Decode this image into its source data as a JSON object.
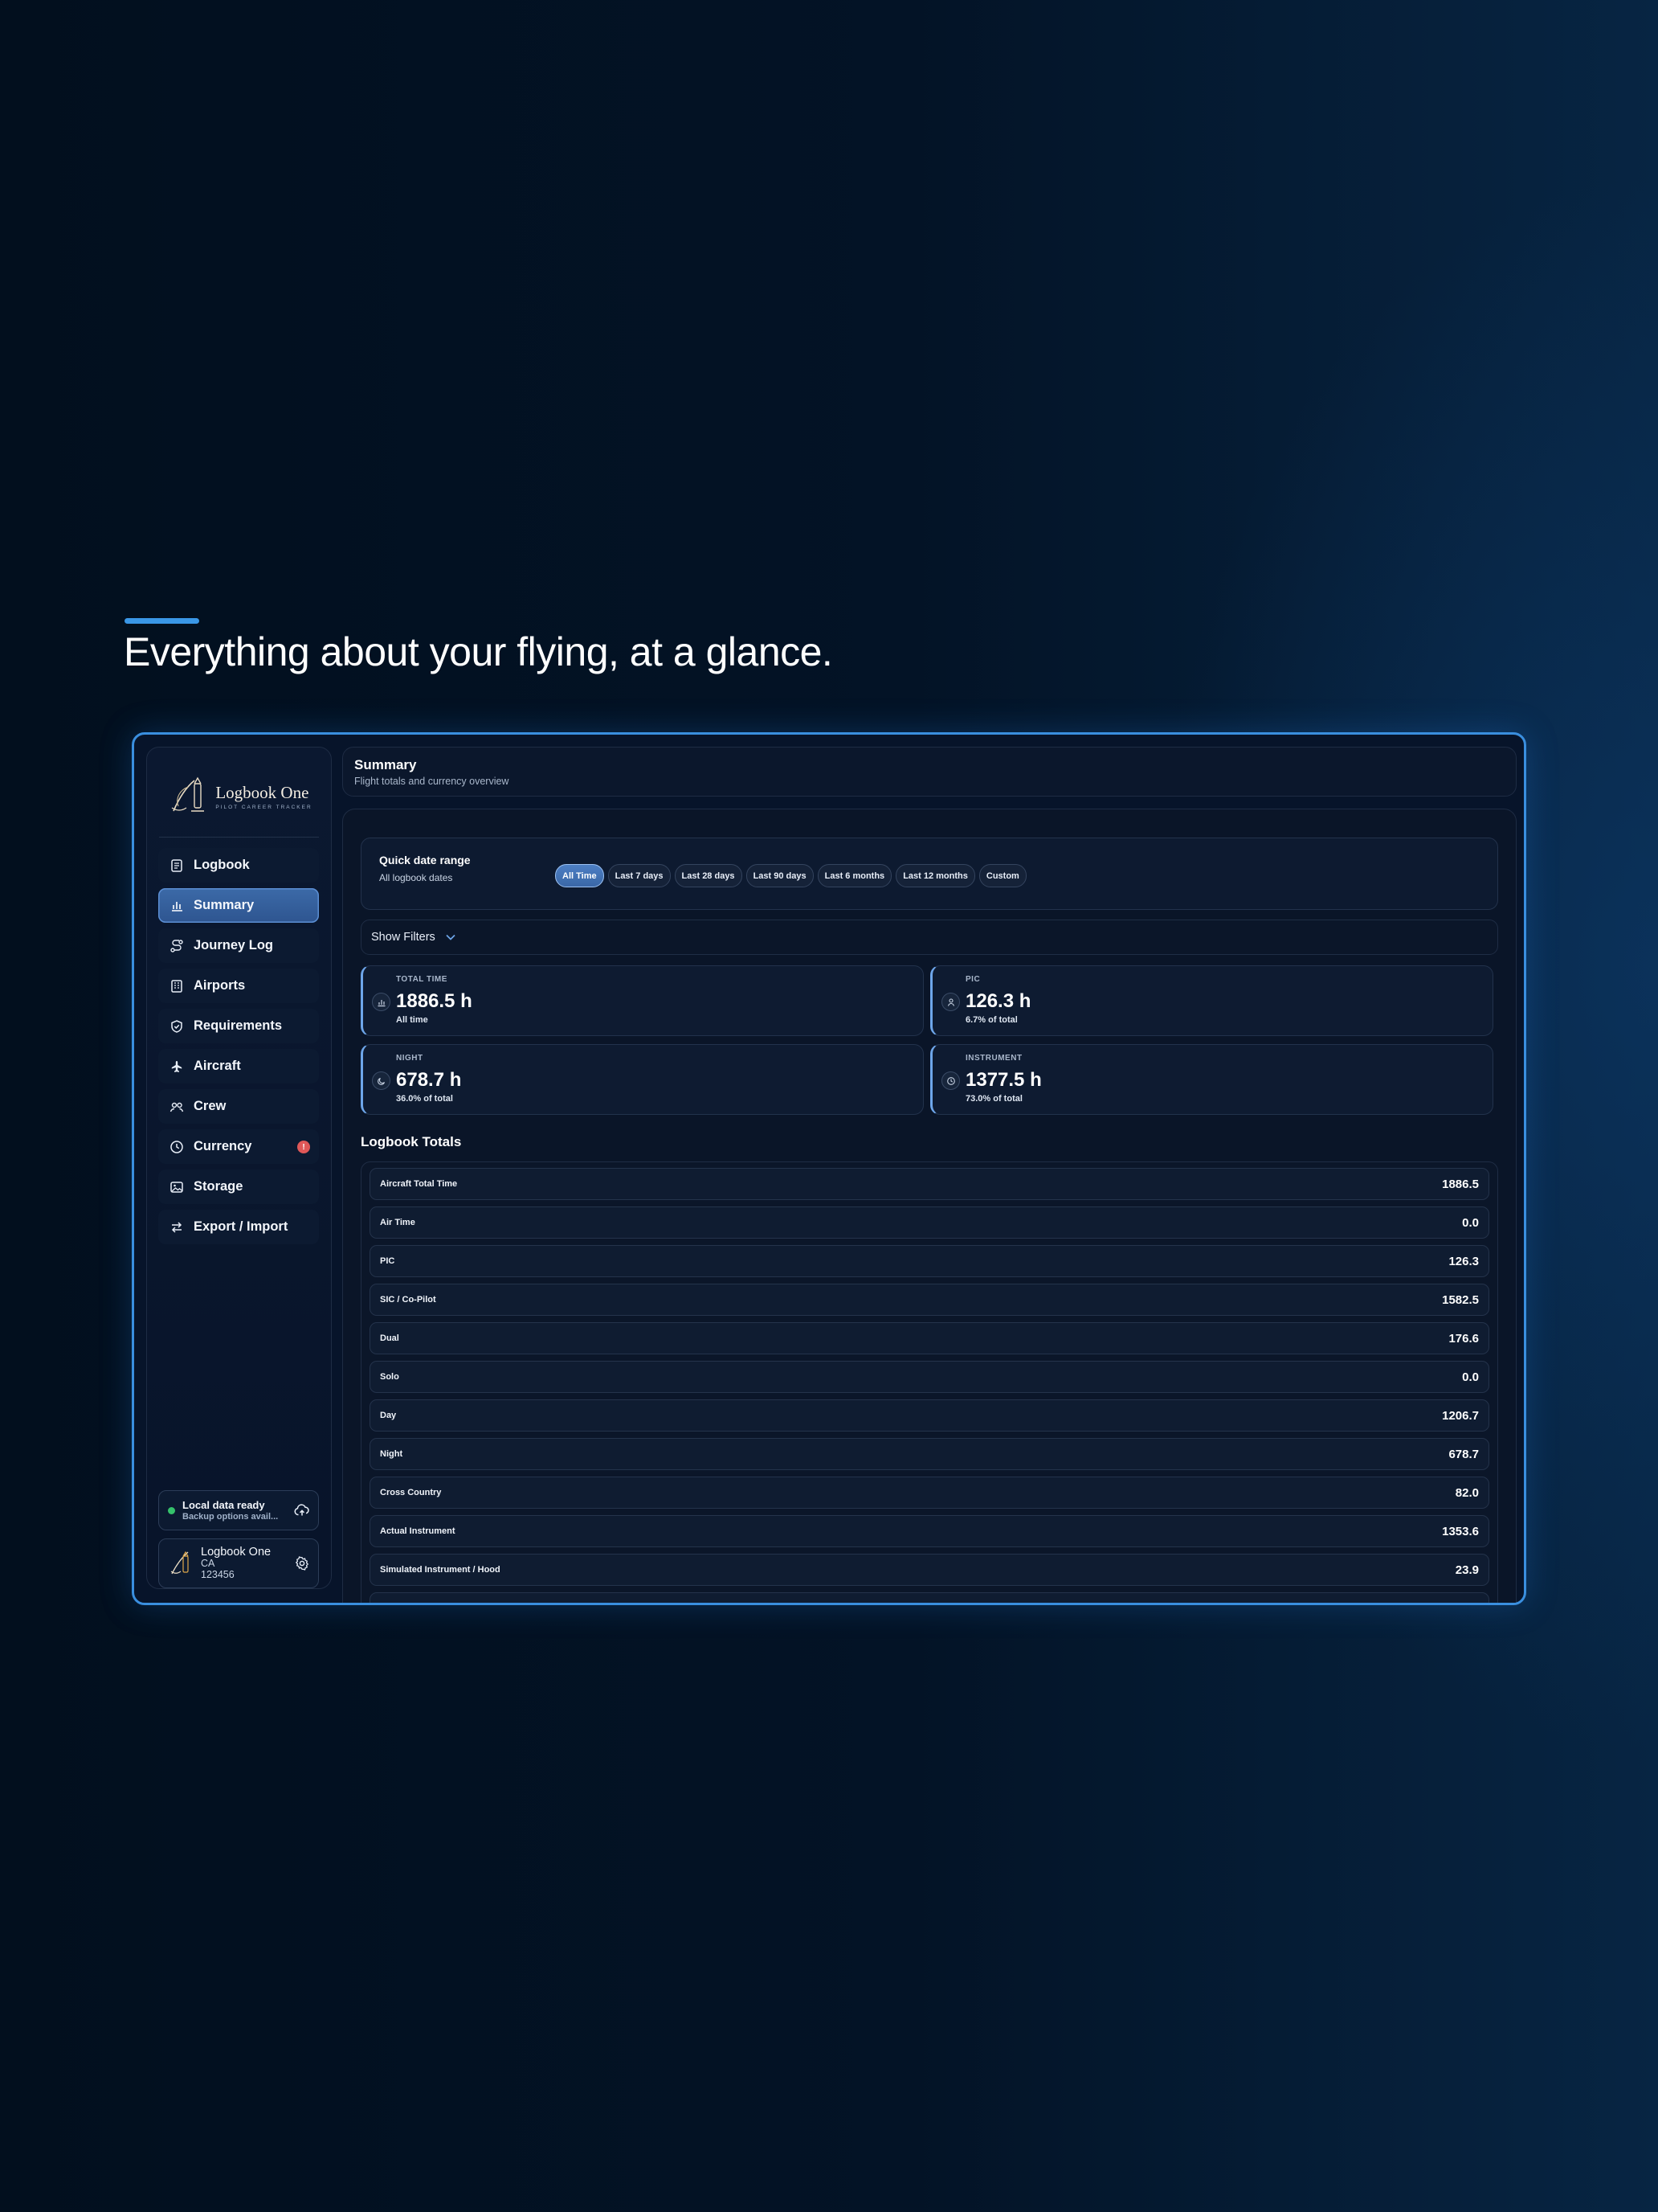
{
  "hero": {
    "title": "Everything about your flying, at a glance."
  },
  "brand": {
    "name": "Logbook One",
    "tagline": "PILOT CAREER TRACKER"
  },
  "sidebar": {
    "items": [
      {
        "label": "Logbook",
        "icon": "book-icon"
      },
      {
        "label": "Summary",
        "icon": "bar-chart-icon",
        "active": true
      },
      {
        "label": "Journey Log",
        "icon": "route-icon"
      },
      {
        "label": "Airports",
        "icon": "building-icon"
      },
      {
        "label": "Requirements",
        "icon": "shield-check-icon"
      },
      {
        "label": "Aircraft",
        "icon": "plane-icon"
      },
      {
        "label": "Crew",
        "icon": "users-icon"
      },
      {
        "label": "Currency",
        "icon": "clock-icon",
        "badge": "!"
      },
      {
        "label": "Storage",
        "icon": "image-icon"
      },
      {
        "label": "Export / Import",
        "icon": "swap-icon"
      }
    ],
    "status": {
      "title": "Local data ready",
      "subtitle": "Backup options avail...",
      "dot_color": "#35c26b"
    },
    "profile": {
      "name": "Logbook One",
      "line1": "CA",
      "line2": "123456"
    }
  },
  "header": {
    "title": "Summary",
    "subtitle": "Flight totals and currency overview"
  },
  "date_range": {
    "title": "Quick date range",
    "subtitle": "All logbook dates",
    "options": [
      "All Time",
      "Last 7 days",
      "Last 28 days",
      "Last 90 days",
      "Last 6 months",
      "Last 12 months",
      "Custom"
    ],
    "selected": "All Time"
  },
  "filters": {
    "label": "Show Filters"
  },
  "stats": [
    {
      "label": "TOTAL TIME",
      "value": "1886.5 h",
      "sub": "All time",
      "icon": "bar-chart-icon"
    },
    {
      "label": "PIC",
      "value": "126.3 h",
      "sub": "6.7% of total",
      "icon": "person-icon"
    },
    {
      "label": "NIGHT",
      "value": "678.7 h",
      "sub": "36.0% of total",
      "icon": "moon-icon"
    },
    {
      "label": "INSTRUMENT",
      "value": "1377.5 h",
      "sub": "73.0% of total",
      "icon": "clock-icon"
    }
  ],
  "totals": {
    "heading": "Logbook Totals",
    "rows": [
      {
        "label": "Aircraft Total Time",
        "value": "1886.5"
      },
      {
        "label": "Air Time",
        "value": "0.0"
      },
      {
        "label": "PIC",
        "value": "126.3"
      },
      {
        "label": "SIC / Co-Pilot",
        "value": "1582.5"
      },
      {
        "label": "Dual",
        "value": "176.6"
      },
      {
        "label": "Solo",
        "value": "0.0"
      },
      {
        "label": "Day",
        "value": "1206.7"
      },
      {
        "label": "Night",
        "value": "678.7"
      },
      {
        "label": "Cross Country",
        "value": "82.0"
      },
      {
        "label": "Actual Instrument",
        "value": "1353.6"
      },
      {
        "label": "Simulated Instrument / Hood",
        "value": "23.9"
      }
    ]
  },
  "colors": {
    "accent": "#3a97e6",
    "active_nav": "#3c6aa8",
    "badge": "#e05858",
    "background": "#031326"
  }
}
